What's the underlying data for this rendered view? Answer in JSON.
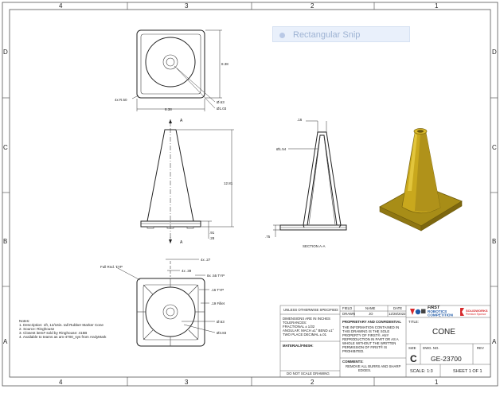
{
  "zones": {
    "columns": [
      "4",
      "3",
      "2",
      "1"
    ],
    "rows": [
      "D",
      "C",
      "B",
      "A"
    ]
  },
  "overlay": {
    "snip_label": "Rectangular Snip"
  },
  "top_view": {
    "dim_width": "8.38",
    "dim_height": "8.38",
    "dim_radius": "4x R.50",
    "dim_inner": "Ø.63",
    "dim_outer": "Ø1.03"
  },
  "front_view": {
    "view_marker": "A",
    "dim_height": "12.81",
    "dim_base": ".91",
    "dim_base2": ".28"
  },
  "section_view": {
    "dim_top": ".16",
    "dim_dia": "Ø1.54",
    "dim_base": ".75",
    "label": "SECTION A-A"
  },
  "bottom_view": {
    "label_fullrnd": "Full Rnd. TYP",
    "dim_a": "4x .27",
    "dim_b": "4x .39",
    "dim_c": "8x .55 TYP",
    "dim_d": ".16 TYP",
    "dim_e": ".19 Fillet",
    "dim_f": "Ø.63",
    "dim_g": "Ø4.83"
  },
  "notes": {
    "title": "Notes:",
    "lines": [
      "1.   Description: 1ft, 12/16in. tall Rubber Marker Cone",
      "2.   Source: Ringhouse",
      "3.   Closest item# sold by Ringhouse: 415B",
      "4.   Available to teams as am-4700_sys from AndyMark"
    ]
  },
  "title_block": {
    "unless": "UNLESS OTHERWISE SPECIFIED:",
    "dims_lines": [
      "DIMENSIONS ARE IN INCHES",
      "TOLERANCES:",
      "FRACTIONAL ± 1/32",
      "ANGULAR: MACH ±1°  BEND ±1°",
      "TWO PLACE DECIMAL   ±.01"
    ],
    "material": "MATERIAL/FINISH:",
    "do_not_scale": "DO NOT SCALE DRAWING",
    "h_field": "FIELD",
    "h_name": "NAME",
    "h_date": "DATE",
    "drawn_label": "DRAWN",
    "drawn_name": "JO",
    "drawn_date": "12/28/2022",
    "proprietary": "PROPRIETARY AND CONFIDENTIAL",
    "prop_lines": [
      "THE INFORMATION CONTAINED IN",
      "THIS DRAWING IS THE SOLE",
      "PROPERTY OF FIRST®. ANY",
      "REPRODUCTION IN PART OR AS A",
      "WHOLE WITHOUT THE WRITTEN",
      "PERMISSION OF FIRST® IS",
      "PROHIBITED."
    ],
    "comments": "COMMENTS:",
    "comment_lines": [
      "REMOVE ALL BURRS AND SHARP",
      "EDGES."
    ],
    "logo_first": "FIRST",
    "logo_robotics": "ROBOTICS",
    "logo_competition": "COMPETITION",
    "logo_solidworks": "SOLIDWORKS",
    "logo_solidworks_sub": "Premium Sponsor",
    "title_label": "TITLE:",
    "title_value": "CONE",
    "size_label": "SIZE",
    "size_value": "C",
    "dwg_label": "DWG.  NO.",
    "dwg_value": "GE-23700",
    "rev_label": "REV",
    "scale": "SCALE: 1:3",
    "sheet": "SHEET 1 OF 1"
  },
  "colors": {
    "cone_body": "#c9a81d",
    "cone_dark": "#8f7612",
    "cone_light": "#e2c53c",
    "logo_red": "#d6282b",
    "logo_blue": "#1f5aa8"
  }
}
